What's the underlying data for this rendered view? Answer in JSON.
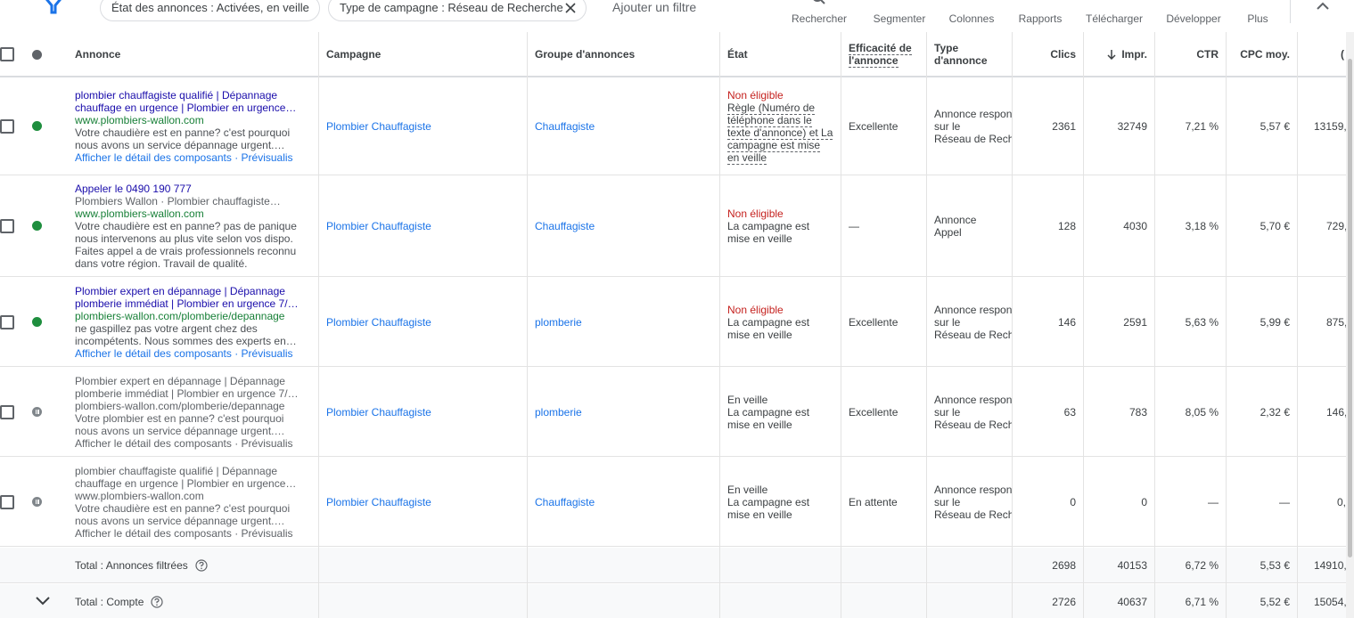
{
  "filters": {
    "chip1": "État des annonces : Activées, en veille",
    "chip2": "Type de campagne : Réseau de Recherche",
    "add_filter": "Ajouter un filtre"
  },
  "toolbar": {
    "search": "Rechercher",
    "segment": "Segmenter",
    "columns": "Colonnes",
    "reports": "Rapports",
    "download": "Télécharger",
    "expand": "Développer",
    "more": "Plus"
  },
  "headers": {
    "ad": "Annonce",
    "campaign": "Campagne",
    "ad_group": "Groupe d'annonces",
    "status": "État",
    "effectiveness_1": "Efficacité de",
    "effectiveness_2": "l'annonce",
    "type_1": "Type",
    "type_2": "d'annonce",
    "clicks": "Clics",
    "impr": "Impr.",
    "ctr": "CTR",
    "cpc": "CPC moy.",
    "cost": "("
  },
  "rows": [
    {
      "ad_lines": [
        "plombier chauffagiste qualifié | Dépannage",
        "chauffage en urgence | Plombier en urgence…"
      ],
      "url": "www.plombiers-wallon.com",
      "desc": [
        "Votre chaudière est en panne? c'est pourquoi",
        "nous avons un service dépannage urgent.…"
      ],
      "links": "Afficher le détail des composants · Prévisualis",
      "campaign": "Plombier Chauffagiste",
      "ad_group": "Chauffagiste",
      "status_title": "Non éligible",
      "status_detail": [
        "Règle (Numéro de",
        "téléphone dans le",
        "texte d'annonce) et La",
        "campagne est mise",
        "en veille"
      ],
      "effectiveness": "Excellente",
      "type": [
        "Annonce respon",
        "sur le",
        "Réseau de Rech"
      ],
      "clicks": "2361",
      "impr": "32749",
      "ctr": "7,21 %",
      "cpc": "5,57 €",
      "cost": "13159,"
    },
    {
      "ad_lines": [
        "Appeler le 0490 190 777"
      ],
      "business": "Plombiers Wallon · Plombier chauffagiste…",
      "url": "www.plombiers-wallon.com",
      "desc": [
        "Votre chaudière est en panne? pas de panique",
        "nous intervenons au plus vite selon vos dispo.",
        "Faites appel a de vrais professionnels reconnu",
        "dans votre région. Travail de qualité."
      ],
      "campaign": "Plombier Chauffagiste",
      "ad_group": "Chauffagiste",
      "status_title": "Non éligible",
      "status_detail": [
        "La campagne est",
        "mise en veille"
      ],
      "effectiveness": "—",
      "type": [
        "Annonce",
        "Appel"
      ],
      "clicks": "128",
      "impr": "4030",
      "ctr": "3,18 %",
      "cpc": "5,70 €",
      "cost": "729,"
    },
    {
      "ad_lines": [
        "Plombier expert en dépannage | Dépannage",
        "plomberie immédiat | Plombier en urgence 7/…"
      ],
      "url": "plombiers-wallon.com/plomberie/depannage",
      "desc": [
        "ne gaspillez pas votre argent chez des",
        "incompétents. Nous sommes des experts en…"
      ],
      "links": "Afficher le détail des composants · Prévisualis",
      "campaign": "Plombier Chauffagiste",
      "ad_group": "plomberie",
      "status_title": "Non éligible",
      "status_detail": [
        "La campagne est",
        "mise en veille"
      ],
      "effectiveness": "Excellente",
      "type": [
        "Annonce respon",
        "sur le",
        "Réseau de Rech"
      ],
      "clicks": "146",
      "impr": "2591",
      "ctr": "5,63 %",
      "cpc": "5,99 €",
      "cost": "875,"
    },
    {
      "ad_lines": [
        "Plombier expert en dépannage | Dépannage",
        "plomberie immédiat | Plombier en urgence 7/…"
      ],
      "url": "plombiers-wallon.com/plomberie/depannage",
      "desc": [
        "Votre plombier est en panne? c'est pourquoi",
        "nous avons un service dépannage urgent.…"
      ],
      "links": "Afficher le détail des composants · Prévisualis",
      "campaign": "Plombier Chauffagiste",
      "ad_group": "plomberie",
      "status_title": "En veille",
      "status_detail": [
        "La campagne est",
        "mise en veille"
      ],
      "effectiveness": "Excellente",
      "type": [
        "Annonce respon",
        "sur le",
        "Réseau de Rech"
      ],
      "clicks": "63",
      "impr": "783",
      "ctr": "8,05 %",
      "cpc": "2,32 €",
      "cost": "146,"
    },
    {
      "ad_lines": [
        "plombier chauffagiste qualifié | Dépannage",
        "chauffage en urgence | Plombier en urgence…"
      ],
      "url": "www.plombiers-wallon.com",
      "desc": [
        "Votre chaudière est en panne? c'est pourquoi",
        "nous avons un service dépannage urgent.…"
      ],
      "links": "Afficher le détail des composants · Prévisualis",
      "campaign": "Plombier Chauffagiste",
      "ad_group": "Chauffagiste",
      "status_title": "En veille",
      "status_detail": [
        "La campagne est",
        "mise en veille"
      ],
      "effectiveness": "En attente",
      "type": [
        "Annonce respon",
        "sur le",
        "Réseau de Rech"
      ],
      "clicks": "0",
      "impr": "0",
      "ctr": "—",
      "cpc": "—",
      "cost": "0,"
    }
  ],
  "totals": {
    "filtered_label": "Total : Annonces filtrées",
    "filtered": {
      "clicks": "2698",
      "impr": "40153",
      "ctr": "6,72 %",
      "cpc": "5,53 €",
      "cost": "14910,"
    },
    "account_label": "Total : Compte",
    "account": {
      "clicks": "2726",
      "impr": "40637",
      "ctr": "6,71 %",
      "cpc": "5,52 €",
      "cost": "15054,"
    }
  }
}
